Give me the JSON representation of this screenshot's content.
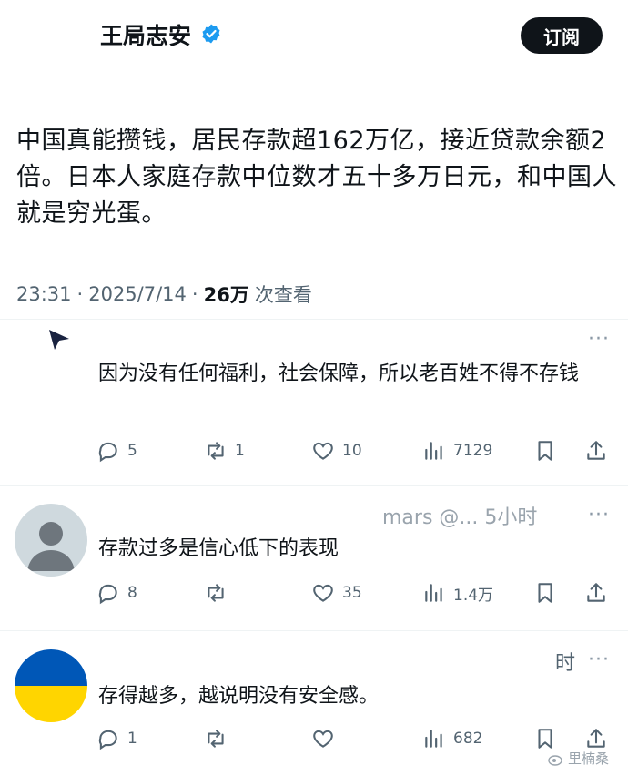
{
  "post": {
    "author_name": "王局志安",
    "subscribe_label": "订阅",
    "text": "中国真能攒钱，居民存款超162万亿，接近贷款余额2倍。日本人家庭存款中位数才五十多万日元，和中国人就是穷光蛋。",
    "time": "23:31",
    "date": "2025/7/14",
    "views_count": "26万",
    "views_label": "次查看"
  },
  "replies": [
    {
      "text": "因为没有任何福利，社会保障，所以老百姓不得不存钱",
      "more": "···",
      "stats": {
        "replies": "5",
        "reposts": "1",
        "likes": "10",
        "views": "7129"
      }
    },
    {
      "header_fragment": "mars @... 5小时",
      "text": "存款过多是信心低下的表现",
      "more": "···",
      "stats": {
        "replies": "8",
        "reposts": "",
        "likes": "35",
        "views": "1.4万"
      }
    },
    {
      "header_fragment": "时",
      "text": "存得越多，越说明没有安全感。",
      "more": "···",
      "stats": {
        "replies": "1",
        "reposts": "",
        "likes": "",
        "views": "682"
      }
    }
  ],
  "watermark": "里楠桑",
  "colors": {
    "accent_verified": "#1d9bf0",
    "text_primary": "#0f1419",
    "text_secondary": "#536471",
    "button_bg": "#0f1419",
    "flag_blue": "#0057b7",
    "flag_yellow": "#ffd500",
    "avatar_grey": "#cfd9de"
  },
  "icons": [
    "verified-badge-icon",
    "reply-icon",
    "repost-icon",
    "like-icon",
    "views-icon",
    "bookmark-icon",
    "share-icon",
    "more-icon",
    "weibo-icon"
  ]
}
